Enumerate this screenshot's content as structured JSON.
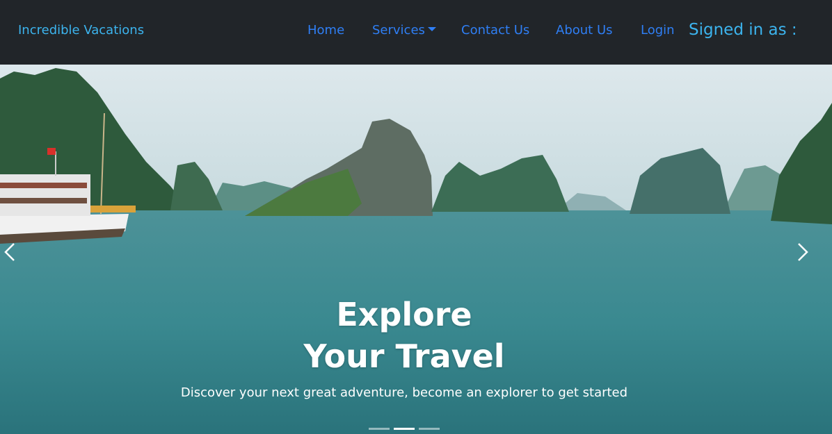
{
  "navbar": {
    "brand": "Incredible Vacations",
    "links": [
      "Home",
      "Services",
      "Contact Us",
      "About Us",
      "Login"
    ],
    "signed_in": "Signed in as :"
  },
  "hero": {
    "title_line1": "Explore",
    "title_line2": "Your Travel",
    "subtitle": "Discover your next great adventure, become an explorer to get started",
    "slide_count": 3,
    "active_slide": 2
  },
  "icons": {
    "prev": "chevron-left-icon",
    "next": "chevron-right-icon",
    "dropdown": "caret-down-icon"
  },
  "colors": {
    "navbar_bg": "#212529",
    "brand": "#3cb4ee",
    "link": "#2f7ff5"
  }
}
